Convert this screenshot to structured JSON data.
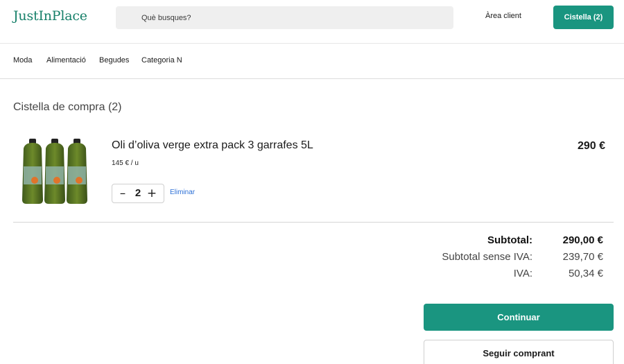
{
  "header": {
    "logo": "JustInPlace",
    "search_placeholder": "Què busques?",
    "area_client": "Àrea client",
    "cart_button": "Cistella (2)"
  },
  "nav": {
    "items": [
      {
        "label": "Moda"
      },
      {
        "label": "Alimentació"
      },
      {
        "label": "Begudes"
      },
      {
        "label": "Categoria N"
      }
    ]
  },
  "cart": {
    "title": "Cistella de compra (2)",
    "items": [
      {
        "name": "Oli d’oliva verge extra pack 3 garrafes 5L",
        "unit_price": "145 € / u",
        "quantity": "2",
        "qty_minus": "–",
        "qty_plus": "+",
        "remove_label": "Eliminar",
        "line_total": "290 €"
      }
    ]
  },
  "summary": {
    "subtotal_label": "Subtotal:",
    "subtotal_value": "290,00 €",
    "subtotal_no_vat_label": "Subtotal sense IVA:",
    "subtotal_no_vat_value": "239,70 €",
    "vat_label": "IVA:",
    "vat_value": "50,34 €"
  },
  "actions": {
    "continue_label": "Continuar",
    "keep_shopping_label": "Seguir comprant"
  },
  "colors": {
    "brand": "#1a9580",
    "link": "#2b6fd6"
  }
}
